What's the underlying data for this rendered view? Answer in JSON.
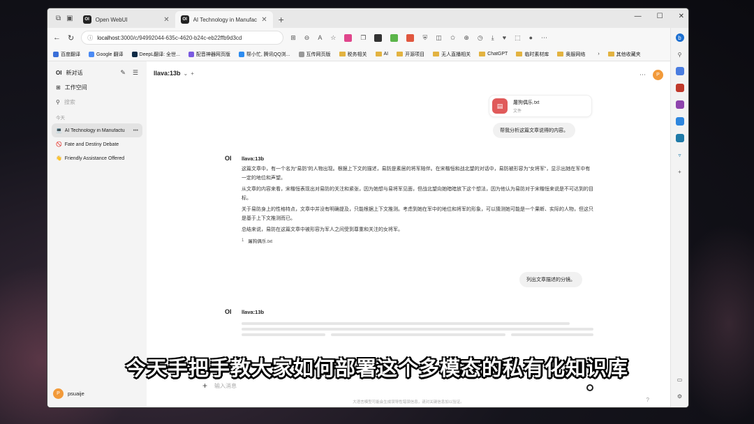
{
  "browser": {
    "tabs": [
      {
        "label": "Open WebUI",
        "active": false
      },
      {
        "label": "AI Technology in Manufactu",
        "active": true
      }
    ],
    "new_tab": "+",
    "url_host": "localhost",
    "url_path": ":3000/c/94992044-635c-4620-b24c-eb22ffb9d3cd",
    "bookmarks": [
      "百度翻译",
      "Google 翻译",
      "DeepL翻译: 全世...",
      "配音神器网页版",
      "帮小忙, 腾讯QQ浏...",
      "互传网页版",
      "税务相关",
      "AI",
      "开源项目",
      "无人直播相关",
      "ChatGPT",
      "临时素材库",
      "奥服网络",
      "其他收藏夹"
    ]
  },
  "sidebar": {
    "new_chat": "新对话",
    "workspace": "工作空间",
    "search_placeholder": "搜索",
    "section_label": "今天",
    "chats": [
      {
        "label": "AI Technology in Manufactu",
        "emoji": "💻",
        "active": true
      },
      {
        "label": "Fate and Destiny Debate",
        "emoji": "🚫",
        "active": false
      },
      {
        "label": "Friendly Assistance Offered",
        "emoji": "👋",
        "active": false
      }
    ],
    "user": {
      "name": "psuaije",
      "initial": "P"
    }
  },
  "main": {
    "model": "llava:13b",
    "model_add": "+",
    "file": {
      "name": "屠狗偶乐.txt",
      "type": "文件"
    },
    "messages": [
      {
        "role": "user",
        "text": "帮我分析这篇文章说得的内容。"
      },
      {
        "role": "assistant",
        "name": "llava:13b",
        "paragraphs": [
          "这篇文章中，有一个名为“易防”的人物出现。根据上下文的描述，易防是素居的将军陪伴。在宋楷恒和战北望的对话中，易防被形容为“女将军”，显示出她在军中有一定的地位和声望。",
          "从文章的内容来看，宋楷恒表现出对易防的关注和紧张，因为她想与易将军见面，但战北望向她暗暗放下这个想法，因为他认为易防对于宋楷恒来说是不可达到的目标。",
          "关于易防身上的性格特点，文章中并没有明确提及，只能根据上下文推测。考虑到她在军中的地位和将军的形象，可以猜测她可能是一个果断、实际的人物，但这只是基于上下文推测而已。",
          "总结来说，易防在这篇文章中被形容为军人之间受到尊重和关注的女将军。"
        ],
        "citation": {
          "num": "1",
          "label": "屠狗偶乐.txt"
        }
      },
      {
        "role": "user",
        "text": "列出文章描述的分镜。"
      },
      {
        "role": "assistant",
        "name": "llava:13b",
        "loading": true
      }
    ],
    "input_placeholder": "输入消息",
    "footer_note": "大语言模型可能会生成误导性错误信息，请对关键信息加以验证。",
    "help": "?"
  },
  "subtitle": "今天手把手教大家如何部署这个多模态的私有化知识库"
}
